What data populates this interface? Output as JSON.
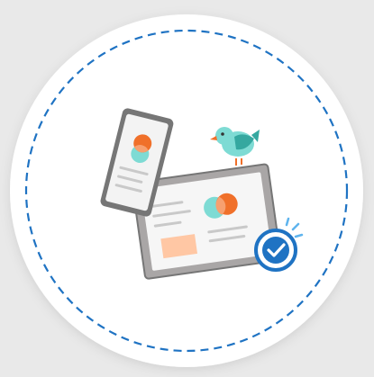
{
  "illustration": {
    "subject": "responsive-devices-with-bird-and-checkmark",
    "colors": {
      "background": "#e9e9e9",
      "circle": "#ffffff",
      "dashed_ring": "#1f73c3",
      "device_frame": "#767676",
      "device_bezel": "#a9a6a6",
      "screen": "#f6f6f6",
      "text_lines": "#c9c9c9",
      "teal": "#7edbd4",
      "orange": "#f0702a",
      "peach_block": "#ffc7a4",
      "bird_body": "#7edbd4",
      "bird_wing": "#35a8a0",
      "bird_beak": "#f0702a",
      "check_badge": "#1f73c3",
      "splash": "#5fb4ee"
    },
    "icons": [
      "phone-icon",
      "tablet-icon",
      "bird-icon",
      "check-badge-icon"
    ]
  }
}
